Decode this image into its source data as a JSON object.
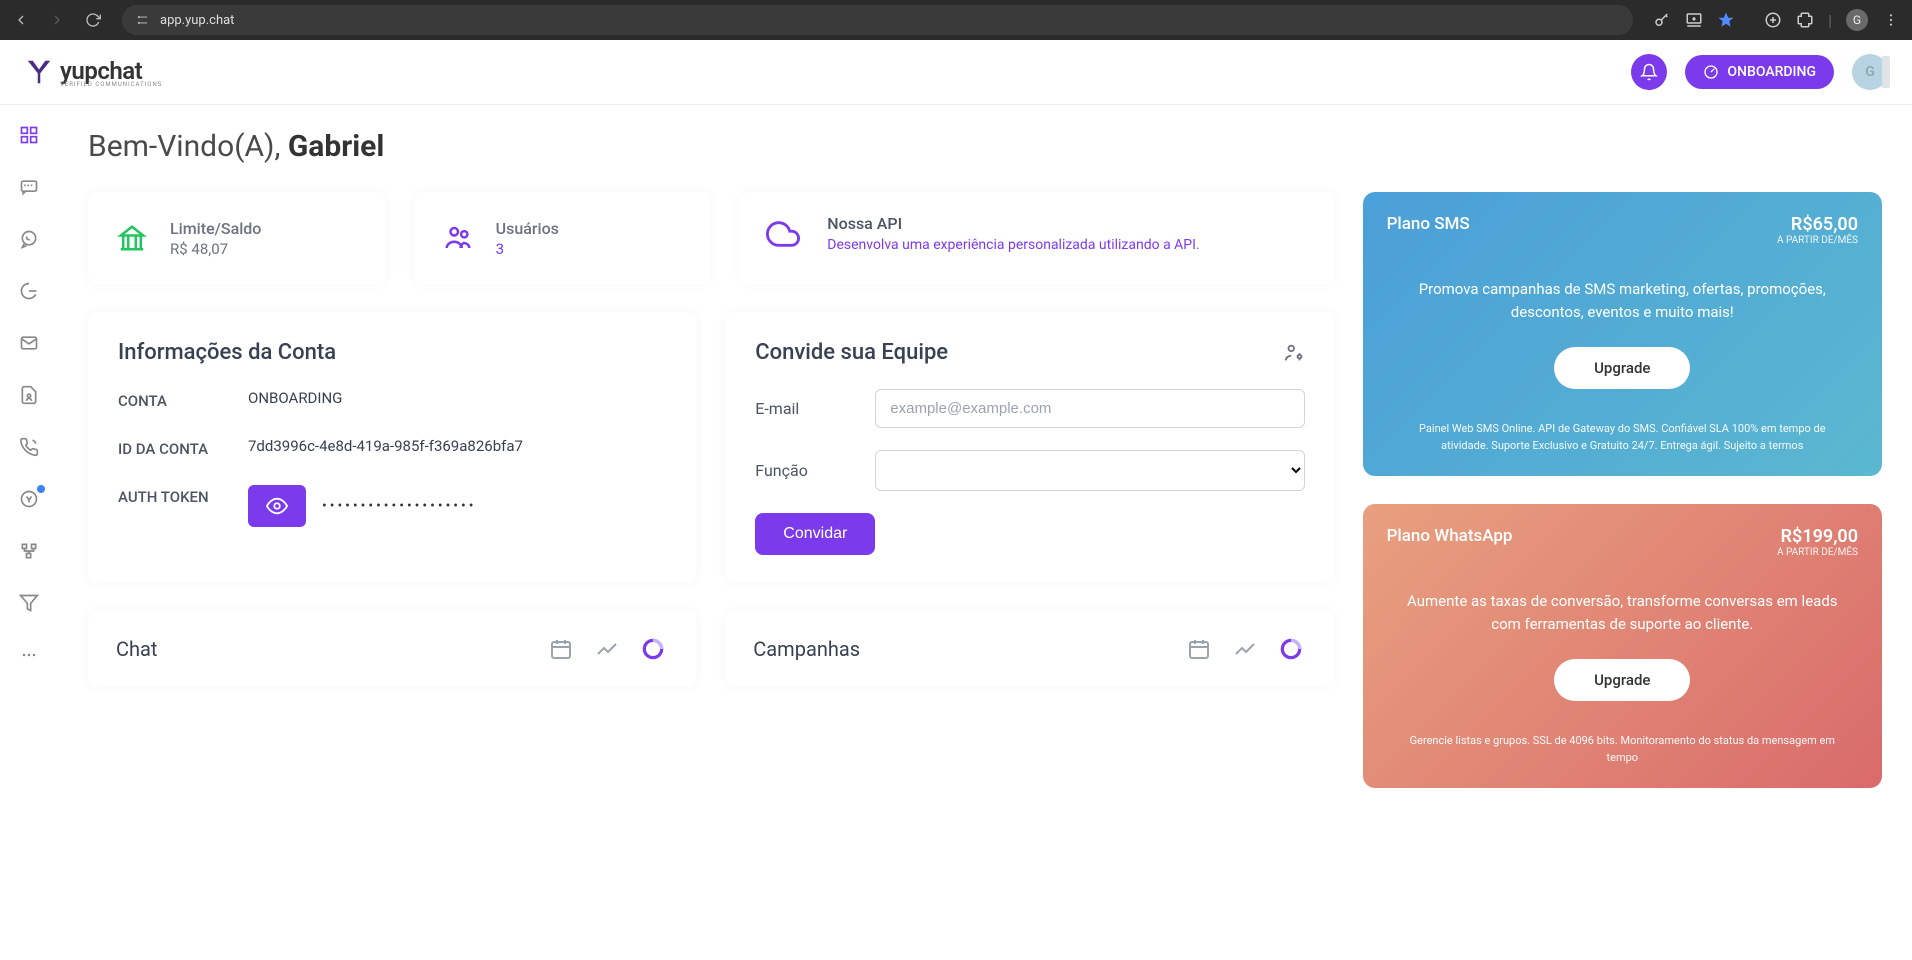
{
  "browser": {
    "url": "app.yup.chat",
    "profile_letter": "G"
  },
  "header": {
    "brand_name": "yupchat",
    "brand_sub": "VERIFIED COMMUNICATIONS",
    "onboarding_label": "ONBOARDING"
  },
  "welcome": {
    "prefix": "Bem-Vindo(A), ",
    "name": "Gabriel"
  },
  "stats": {
    "balance": {
      "label": "Limite/Saldo",
      "value": "R$ 48,07"
    },
    "users": {
      "label": "Usuários",
      "value": "3"
    },
    "api": {
      "label": "Nossa API",
      "desc": "Desenvolva uma experiência personalizada utilizando a API."
    }
  },
  "account": {
    "title": "Informações da Conta",
    "account_label": "CONTA",
    "account_value": "ONBOARDING",
    "id_label": "ID DA CONTA",
    "id_value": "7dd3996c-4e8d-419a-985f-f369a826bfa7",
    "auth_label": "AUTH TOKEN",
    "auth_value": "••••••••••••••••••••"
  },
  "invite": {
    "title": "Convide sua Equipe",
    "email_label": "E-mail",
    "email_placeholder": "example@example.com",
    "role_label": "Função",
    "button": "Convidar"
  },
  "plans": {
    "sms": {
      "name": "Plano SMS",
      "price": "R$65,00",
      "price_sub": "A PARTIR DE/MÊS",
      "desc": "Promova campanhas de SMS marketing, ofertas, promoções, descontos, eventos e muito mais!",
      "cta": "Upgrade",
      "fine": "Painel Web SMS Online. API de Gateway do SMS. Confiável SLA 100% em tempo de atividade. Suporte Exclusivo e Gratuito 24/7. Entrega ágil. Sujeito a termos"
    },
    "wa": {
      "name": "Plano WhatsApp",
      "price": "R$199,00",
      "price_sub": "A PARTIR DE/MÊS",
      "desc": "Aumente as taxas de conversão, transforme conversas em leads com ferramentas de suporte ao cliente.",
      "cta": "Upgrade",
      "fine": "Gerencie listas e grupos. SSL de 4096 bits. Monitoramento do status da mensagem em tempo"
    }
  },
  "charts": {
    "chat": "Chat",
    "campaigns": "Campanhas"
  }
}
